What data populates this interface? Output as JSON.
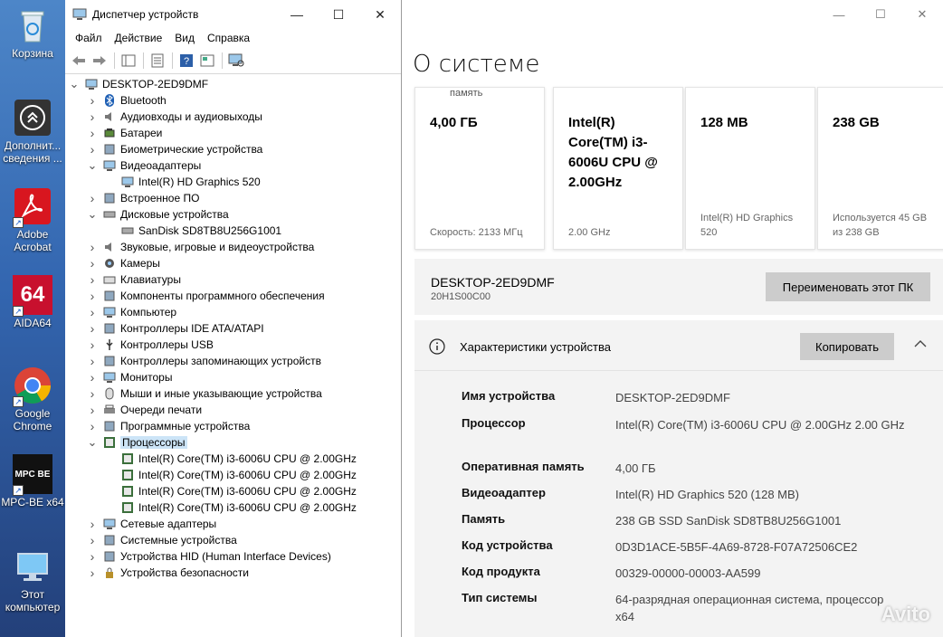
{
  "desktop": {
    "icons": [
      {
        "label": "Корзина"
      },
      {
        "label": "Дополнит... сведения ..."
      },
      {
        "label": "Adobe Acrobat"
      },
      {
        "label": "AIDA64",
        "badge": "64"
      },
      {
        "label": "Google Chrome"
      },
      {
        "label": "MPC-BE x64",
        "badge": "MPC BE"
      },
      {
        "label": "Этот компьютер"
      }
    ]
  },
  "devmgr": {
    "title": "Диспетчер устройств",
    "window_buttons": {
      "minimize": "—",
      "maximize": "☐",
      "close": "✕"
    },
    "menu": [
      "Файл",
      "Действие",
      "Вид",
      "Справка"
    ],
    "tree": [
      {
        "label": "DESKTOP-2ED9DMF",
        "level": 0,
        "state": "expanded",
        "icon": "computer-icon"
      },
      {
        "label": "Bluetooth",
        "level": 1,
        "state": "collapsed",
        "icon": "bluetooth-icon"
      },
      {
        "label": "Аудиовходы и аудиовыходы",
        "level": 1,
        "state": "collapsed",
        "icon": "speaker-icon"
      },
      {
        "label": "Батареи",
        "level": 1,
        "state": "collapsed",
        "icon": "battery-icon"
      },
      {
        "label": "Биометрические устройства",
        "level": 1,
        "state": "collapsed",
        "icon": "fingerprint-icon"
      },
      {
        "label": "Видеоадаптеры",
        "level": 1,
        "state": "expanded",
        "icon": "display-adapter-icon"
      },
      {
        "label": "Intel(R) HD Graphics 520",
        "level": 2,
        "state": "leaf",
        "icon": "display-adapter-icon"
      },
      {
        "label": "Встроенное ПО",
        "level": 1,
        "state": "collapsed",
        "icon": "firmware-icon"
      },
      {
        "label": "Дисковые устройства",
        "level": 1,
        "state": "expanded",
        "icon": "disk-icon"
      },
      {
        "label": "SanDisk SD8TB8U256G1001",
        "level": 2,
        "state": "leaf",
        "icon": "disk-icon"
      },
      {
        "label": "Звуковые, игровые и видеоустройства",
        "level": 1,
        "state": "collapsed",
        "icon": "speaker-icon"
      },
      {
        "label": "Камеры",
        "level": 1,
        "state": "collapsed",
        "icon": "camera-icon"
      },
      {
        "label": "Клавиатуры",
        "level": 1,
        "state": "collapsed",
        "icon": "keyboard-icon"
      },
      {
        "label": "Компоненты программного обеспечения",
        "level": 1,
        "state": "collapsed",
        "icon": "software-component-icon"
      },
      {
        "label": "Компьютер",
        "level": 1,
        "state": "collapsed",
        "icon": "monitor-icon"
      },
      {
        "label": "Контроллеры IDE ATA/ATAPI",
        "level": 1,
        "state": "collapsed",
        "icon": "ide-controller-icon"
      },
      {
        "label": "Контроллеры USB",
        "level": 1,
        "state": "collapsed",
        "icon": "usb-icon"
      },
      {
        "label": "Контроллеры запоминающих устройств",
        "level": 1,
        "state": "collapsed",
        "icon": "storage-controller-icon"
      },
      {
        "label": "Мониторы",
        "level": 1,
        "state": "collapsed",
        "icon": "monitor-icon"
      },
      {
        "label": "Мыши и иные указывающие устройства",
        "level": 1,
        "state": "collapsed",
        "icon": "mouse-icon"
      },
      {
        "label": "Очереди печати",
        "level": 1,
        "state": "collapsed",
        "icon": "printer-icon"
      },
      {
        "label": "Программные устройства",
        "level": 1,
        "state": "collapsed",
        "icon": "software-device-icon"
      },
      {
        "label": "Процессоры",
        "level": 1,
        "state": "expanded",
        "icon": "processor-icon",
        "selected": true
      },
      {
        "label": "Intel(R) Core(TM) i3-6006U CPU @ 2.00GHz",
        "level": 2,
        "state": "leaf",
        "icon": "processor-icon"
      },
      {
        "label": "Intel(R) Core(TM) i3-6006U CPU @ 2.00GHz",
        "level": 2,
        "state": "leaf",
        "icon": "processor-icon"
      },
      {
        "label": "Intel(R) Core(TM) i3-6006U CPU @ 2.00GHz",
        "level": 2,
        "state": "leaf",
        "icon": "processor-icon"
      },
      {
        "label": "Intel(R) Core(TM) i3-6006U CPU @ 2.00GHz",
        "level": 2,
        "state": "leaf",
        "icon": "processor-icon"
      },
      {
        "label": "Сетевые адаптеры",
        "level": 1,
        "state": "collapsed",
        "icon": "network-adapter-icon"
      },
      {
        "label": "Системные устройства",
        "level": 1,
        "state": "collapsed",
        "icon": "system-device-icon"
      },
      {
        "label": "Устройства HID (Human Interface Devices)",
        "level": 1,
        "state": "collapsed",
        "icon": "hid-icon"
      },
      {
        "label": "Устройства безопасности",
        "level": 1,
        "state": "collapsed",
        "icon": "security-device-icon"
      }
    ]
  },
  "settings": {
    "page_title": "О системе",
    "window_buttons": {
      "minimize": "—",
      "maximize": "☐",
      "close": "✕"
    },
    "cards": [
      {
        "top_label": "память",
        "value": "4,00 ГБ",
        "footer": "Скорость: 2133 МГц"
      },
      {
        "top_label": "",
        "value": "Intel(R) Core(TM) i3-6006U CPU @ 2.00GHz",
        "footer": "2.00 GHz"
      },
      {
        "top_label": "",
        "value": "128 MB",
        "footer": "Intel(R) HD Graphics 520"
      },
      {
        "top_label": "",
        "value": "238 GB",
        "footer": "Используется 45 GB из 238 GB"
      }
    ],
    "pc": {
      "name": "DESKTOP-2ED9DMF",
      "model": "20H1S00C00",
      "rename_label": "Переименовать этот ПК"
    },
    "specs": {
      "header": "Характеристики устройства",
      "copy_label": "Копировать",
      "rows": [
        {
          "key": "Имя устройства",
          "value": "DESKTOP-2ED9DMF"
        },
        {
          "key": "Процессор",
          "value": "Intel(R) Core(TM) i3-6006U CPU @ 2.00GHz   2.00 GHz"
        },
        {
          "key": "Оперативная память",
          "value": "4,00 ГБ"
        },
        {
          "key": "Видеоадаптер",
          "value": "Intel(R) HD Graphics 520 (128 MB)"
        },
        {
          "key": "Память",
          "value": "238 GB SSD SanDisk SD8TB8U256G1001"
        },
        {
          "key": "Код устройства",
          "value": "0D3D1ACE-5B5F-4A69-8728-F07A72506CE2"
        },
        {
          "key": "Код продукта",
          "value": "00329-00000-00003-AA599"
        },
        {
          "key": "Тип системы",
          "value": "64-разрядная операционная система, процессор x64"
        }
      ]
    },
    "watermark": "Avito"
  }
}
